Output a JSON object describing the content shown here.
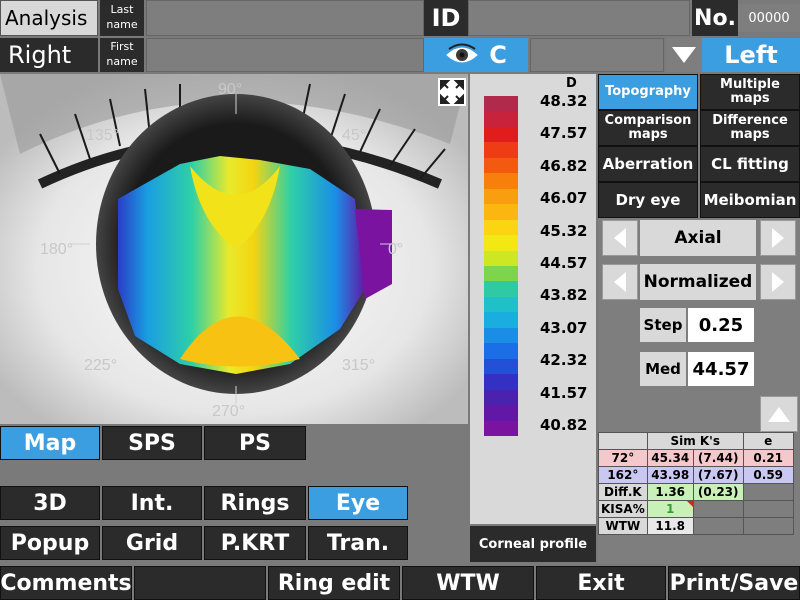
{
  "header": {
    "analysis": "Analysis",
    "eye_side_active": "Right",
    "last_name_label": "Last\nname",
    "first_name_label": "First\nname",
    "id_label": "ID",
    "no_label": "No.",
    "no_value": "00000",
    "eye_letter": "C",
    "left_label": "Left"
  },
  "map": {
    "angle_labels": [
      "90°",
      "45°",
      "135°",
      "180°",
      "0°",
      "225°",
      "315°",
      "270°"
    ]
  },
  "scale": {
    "unit": "D",
    "values": [
      "48.32",
      "47.57",
      "46.82",
      "46.07",
      "45.32",
      "44.57",
      "43.82",
      "43.07",
      "42.32",
      "41.57",
      "40.82"
    ],
    "colors": [
      "#b22a4b",
      "#c8233c",
      "#e01c1c",
      "#ee3c14",
      "#f25a10",
      "#f7800d",
      "#f99e0e",
      "#fbb710",
      "#fcd512",
      "#f4e814",
      "#cde822",
      "#7ed44a",
      "#2fc9a6",
      "#1fc0c8",
      "#1aaee0",
      "#1a8ee6",
      "#1a6ee6",
      "#2450d8",
      "#3430c4",
      "#4a22ae",
      "#6218a6",
      "#7a14a0"
    ]
  },
  "corneal_profile": "Corneal profile",
  "right_panel": {
    "topography": "Topography",
    "multiple_maps": "Multiple maps",
    "comparison_maps": "Comparison maps",
    "difference_maps": "Difference maps",
    "aberration": "Aberration",
    "cl_fitting": "CL fitting",
    "dry_eye": "Dry eye",
    "meibomian": "Meibomian",
    "map_type": "Axial",
    "scale_type": "Normalized",
    "step_label": "Step",
    "step_value": "0.25",
    "med_label": "Med",
    "med_value": "44.57"
  },
  "simk": {
    "header": [
      "",
      "Sim K's",
      "",
      "e"
    ],
    "rows": [
      [
        "72°",
        "45.34",
        "(7.44)",
        "0.21"
      ],
      [
        "162°",
        "43.98",
        "(7.67)",
        "0.59"
      ],
      [
        "Diff.K",
        "1.36",
        "(0.23)",
        ""
      ],
      [
        "KISA%",
        "1",
        "",
        ""
      ],
      [
        "WTW",
        "11.8",
        "",
        ""
      ]
    ]
  },
  "view_tabs": [
    "Map",
    "SPS",
    "PS"
  ],
  "toggles_row1": [
    "3D",
    "Int.",
    "Rings",
    "Eye"
  ],
  "toggles_row2": [
    "Popup",
    "Grid",
    "P.KRT",
    "Tran."
  ],
  "footer": [
    "Comments",
    "",
    "Ring edit",
    "WTW",
    "Exit",
    "Print/Save"
  ],
  "colors": {
    "accent": "#3b9ee0",
    "dark": "#2b2b2b",
    "panel": "#7e7e7e"
  }
}
